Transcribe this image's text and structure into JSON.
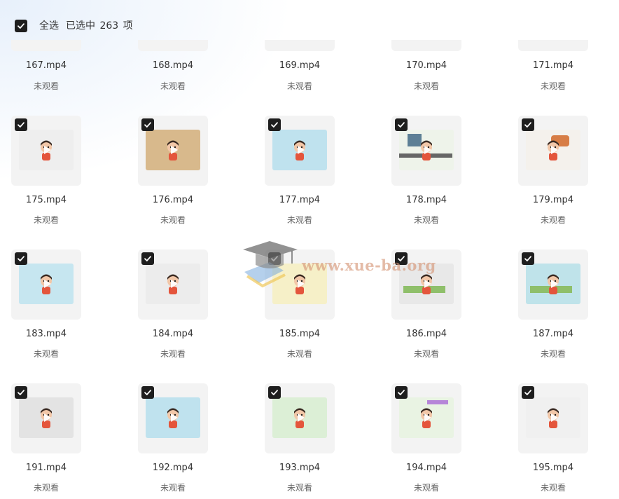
{
  "header": {
    "select_all_label": "全选",
    "selected_prefix": "已选中",
    "selected_count": "263",
    "selected_suffix": "项"
  },
  "watermark": {
    "text": "www.xue-ba.org"
  },
  "rows": [
    {
      "partial": true,
      "items": [
        {
          "name": "167.mp4",
          "status": "未观看"
        },
        {
          "name": "168.mp4",
          "status": "未观看"
        },
        {
          "name": "169.mp4",
          "status": "未观看"
        },
        {
          "name": "170.mp4",
          "status": "未观看"
        },
        {
          "name": "171.mp4",
          "status": "未观看"
        }
      ]
    },
    {
      "partial": false,
      "items": [
        {
          "name": "175.mp4",
          "status": "未观看",
          "scene": "closeup",
          "bg": "#eeeeee"
        },
        {
          "name": "176.mp4",
          "status": "未观看",
          "scene": "wood",
          "bg": "#d8b98c"
        },
        {
          "name": "177.mp4",
          "status": "未观看",
          "scene": "standing",
          "bg": "#bfe2ee"
        },
        {
          "name": "178.mp4",
          "status": "未观看",
          "scene": "street",
          "bg": "#eef3ea"
        },
        {
          "name": "179.mp4",
          "status": "未观看",
          "scene": "shop",
          "bg": "#f4f1ec"
        }
      ]
    },
    {
      "partial": false,
      "items": [
        {
          "name": "183.mp4",
          "status": "未观看",
          "scene": "eating",
          "bg": "#c6e6f0"
        },
        {
          "name": "184.mp4",
          "status": "未观看",
          "scene": "table",
          "bg": "#ececec"
        },
        {
          "name": "185.mp4",
          "status": "未观看",
          "scene": "yellow",
          "bg": "#f6f0c8"
        },
        {
          "name": "186.mp4",
          "status": "未观看",
          "scene": "town",
          "bg": "#e8e8e8"
        },
        {
          "name": "187.mp4",
          "status": "未观看",
          "scene": "garden",
          "bg": "#bfe3ea"
        }
      ]
    },
    {
      "partial": false,
      "items": [
        {
          "name": "191.mp4",
          "status": "未观看",
          "scene": "picnic",
          "bg": "#e3e3e3"
        },
        {
          "name": "192.mp4",
          "status": "未观看",
          "scene": "closeup",
          "bg": "#bfe2ee"
        },
        {
          "name": "193.mp4",
          "status": "未观看",
          "scene": "park",
          "bg": "#dcefd6"
        },
        {
          "name": "194.mp4",
          "status": "未观看",
          "scene": "market",
          "bg": "#e9f3e3"
        },
        {
          "name": "195.mp4",
          "status": "未观看",
          "scene": "thinking",
          "bg": "#f0f0f0"
        }
      ]
    }
  ]
}
